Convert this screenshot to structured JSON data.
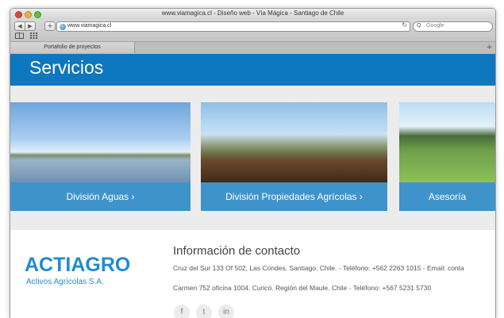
{
  "window": {
    "title": "www.viamagica.cl - Diseño web - Vía Mágica - Santiago de Chile"
  },
  "toolbar": {
    "back_icon": "◀",
    "forward_icon": "▶",
    "add_icon": "+",
    "url": "www.viamagica.cl",
    "reload_icon": "↻",
    "search_placeholder": "Google",
    "search_icon_glyph": "Q"
  },
  "tabs": [
    {
      "label": "Portafolio de proyectos"
    }
  ],
  "tab_plus": "+",
  "hero": {
    "title": "Servicios"
  },
  "cards": [
    {
      "label": "División Aguas  ›"
    },
    {
      "label": "División Propiedades Agrícolas  ›"
    },
    {
      "label": "Asesoría"
    }
  ],
  "footer": {
    "logo_text": "ACTIAGRO",
    "logo_sub": "Activos Agrícolas S.A.",
    "contact_title": "Información de contacto",
    "line1": "Cruz del Sur 133 Of 502, Las Condes. Santiago, Chile.    - Teléfono: +562 2263 1015    - Email: conta",
    "line2": "Carmen 752 oficina 1004. Curicó. Región del Maule. Chile    - Teléfono: +567 5231 5730",
    "social": [
      {
        "glyph": "f"
      },
      {
        "glyph": "t"
      },
      {
        "glyph": "in"
      }
    ]
  },
  "colors": {
    "hero_blue": "#0d77bf",
    "card_caption": "#3f93cb",
    "logo_blue": "#1f8bd3"
  }
}
